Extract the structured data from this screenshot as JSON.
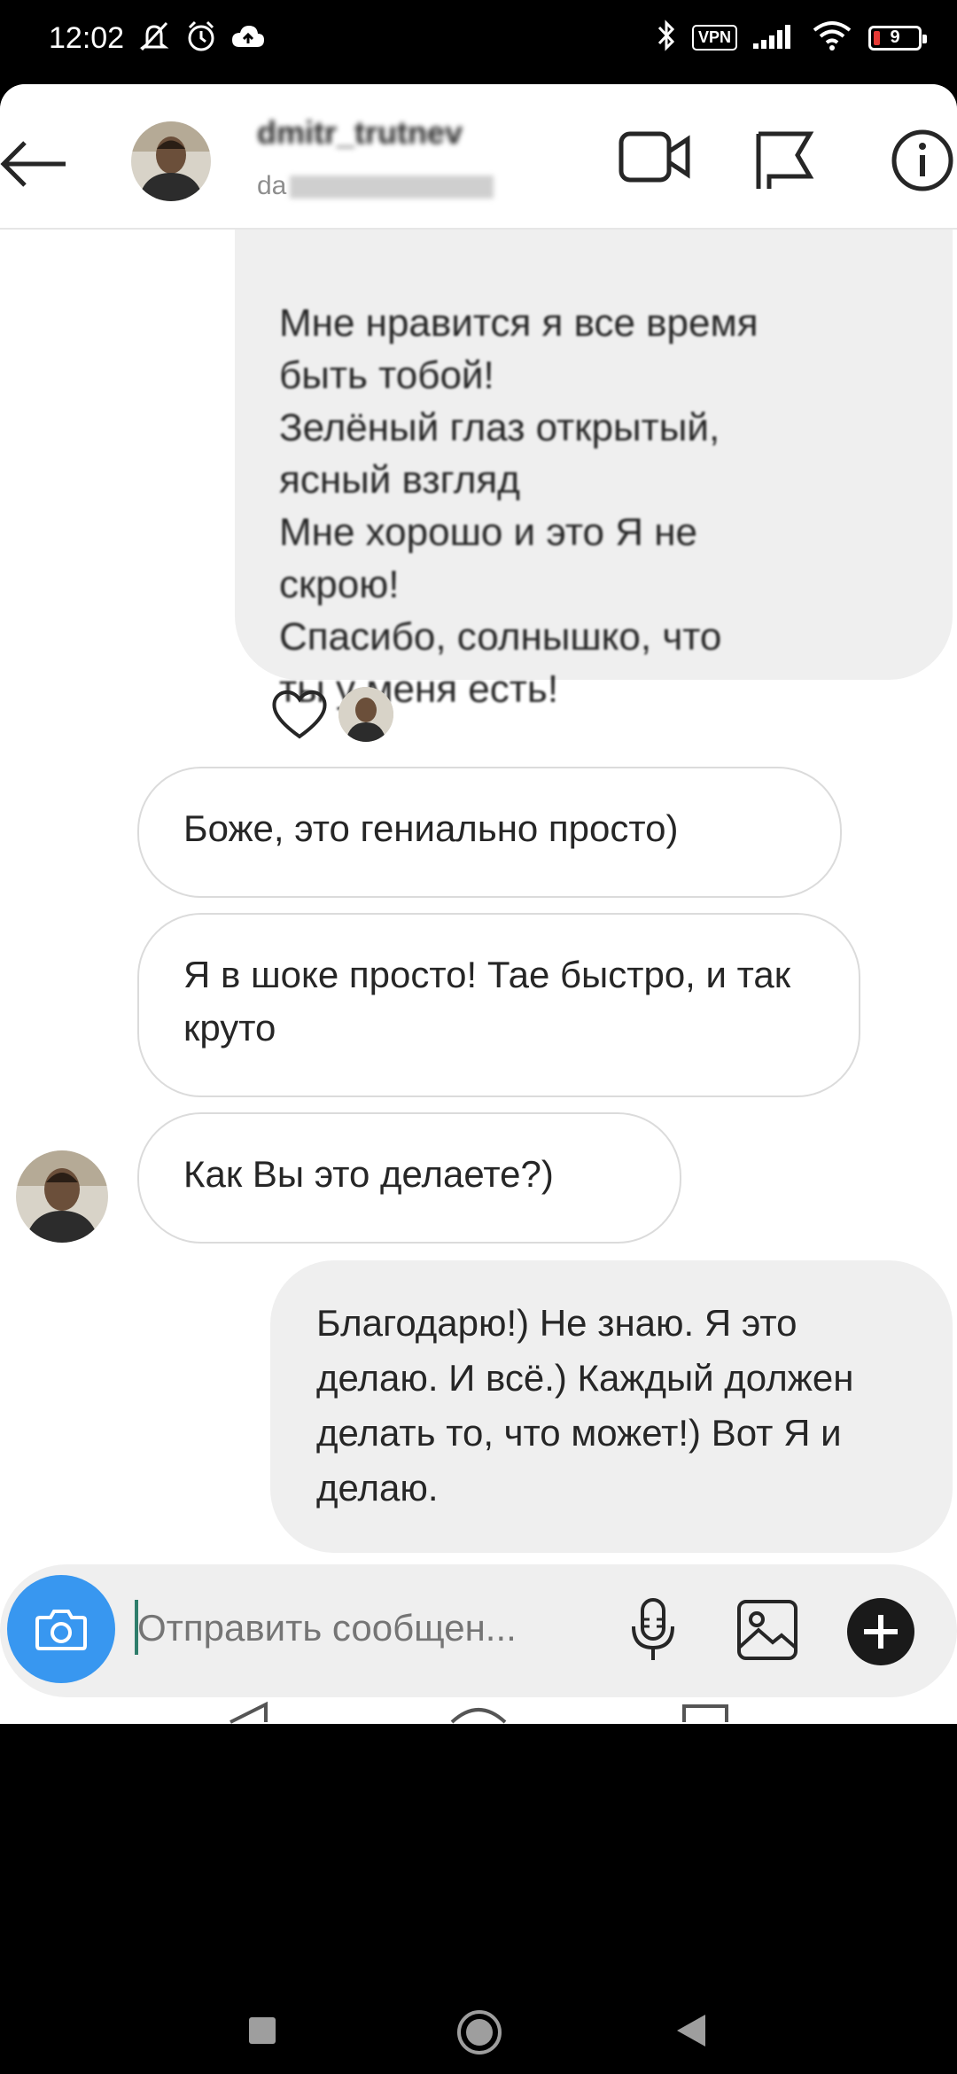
{
  "status_bar": {
    "time": "12:02",
    "vpn_label": "VPN",
    "battery_level": "9",
    "icons": [
      "mute-notifications-icon",
      "alarm-icon",
      "cloud-upload-icon",
      "bluetooth-icon",
      "signal-icon",
      "wifi-icon",
      "battery-icon"
    ]
  },
  "header": {
    "username": "dmitr_trutnev",
    "subtitle_prefix": "da"
  },
  "thread": {
    "outgoing_top_lines": [
      "Мне нравится я все время",
      "быть тобой!",
      "Зелёный глаз открытый,",
      "ясный взгляд",
      "Мне хорошо и это Я не",
      "скрою!",
      "Спасибо, солнышко, что",
      "ты у меня есть!"
    ],
    "incoming": [
      "Боже, это гениально просто)",
      "Я в шоке просто! Тае быстро, и так круто",
      "Как Вы это делаете?)"
    ],
    "outgoing_reply": "Благодарю!) Не знаю. Я это делаю. И всё.) Каждый должен делать то, что может!) Вот Я и делаю."
  },
  "composer": {
    "placeholder": "Отправить сообщен..."
  }
}
